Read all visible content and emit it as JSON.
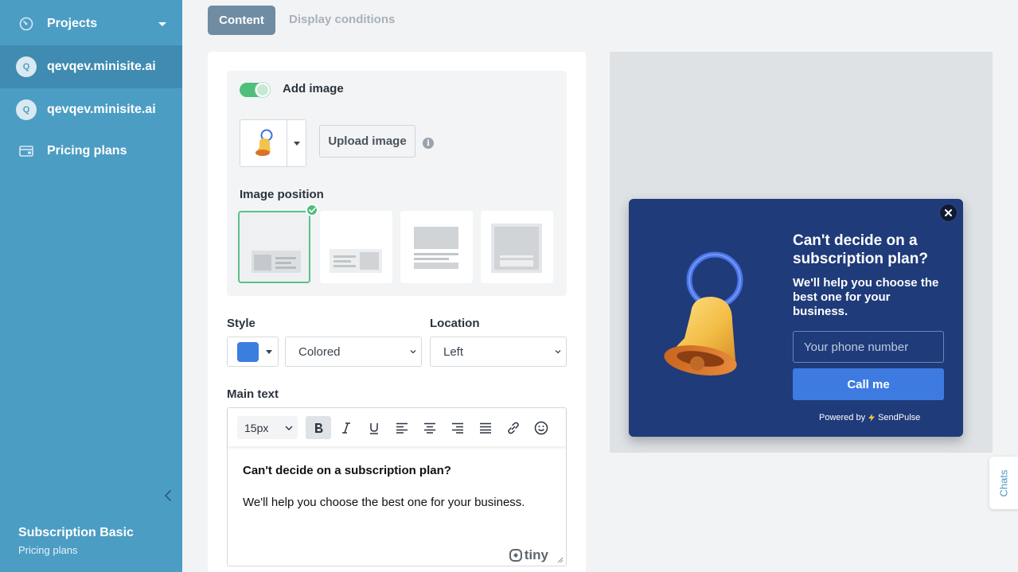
{
  "sidebar": {
    "projects_label": "Projects",
    "sites": [
      {
        "avatar": "Q",
        "label": "qevqev.minisite.ai",
        "active": true
      },
      {
        "avatar": "Q",
        "label": "qevqev.minisite.ai",
        "active": false
      }
    ],
    "pricing_label": "Pricing plans",
    "footer": {
      "plan": "Subscription Basic",
      "link": "Pricing plans"
    },
    "colors": {
      "background": "#4c9dc4",
      "active": "#3f8bb1"
    }
  },
  "tabs": [
    {
      "label": "Content",
      "active": true
    },
    {
      "label": "Display conditions",
      "active": false
    }
  ],
  "form": {
    "add_image": {
      "label": "Add image",
      "enabled": true
    },
    "upload_label": "Upload image",
    "image_position_label": "Image position",
    "positions": [
      "left-image",
      "right-image",
      "top-image",
      "background-image"
    ],
    "selected_position": 0,
    "style": {
      "label": "Style",
      "color": "#3c7de0",
      "value": "Colored"
    },
    "location": {
      "label": "Location",
      "value": "Left"
    },
    "main_text": {
      "label": "Main text",
      "font_size": "15px",
      "line1": "Can't decide on a subscription plan?",
      "line2": "We'll help you choose the best one for your business.",
      "brand": "tiny"
    }
  },
  "popup": {
    "title": "Can't decide on a subscription plan?",
    "text": "We'll help you choose the best one for your business.",
    "phone_placeholder": "Your phone number",
    "button": "Call me",
    "powered_prefix": "Powered by",
    "powered_brand": "SendPulse",
    "background": "#1f3b7a",
    "button_color": "#3e7be0"
  },
  "chats_label": "Chats"
}
